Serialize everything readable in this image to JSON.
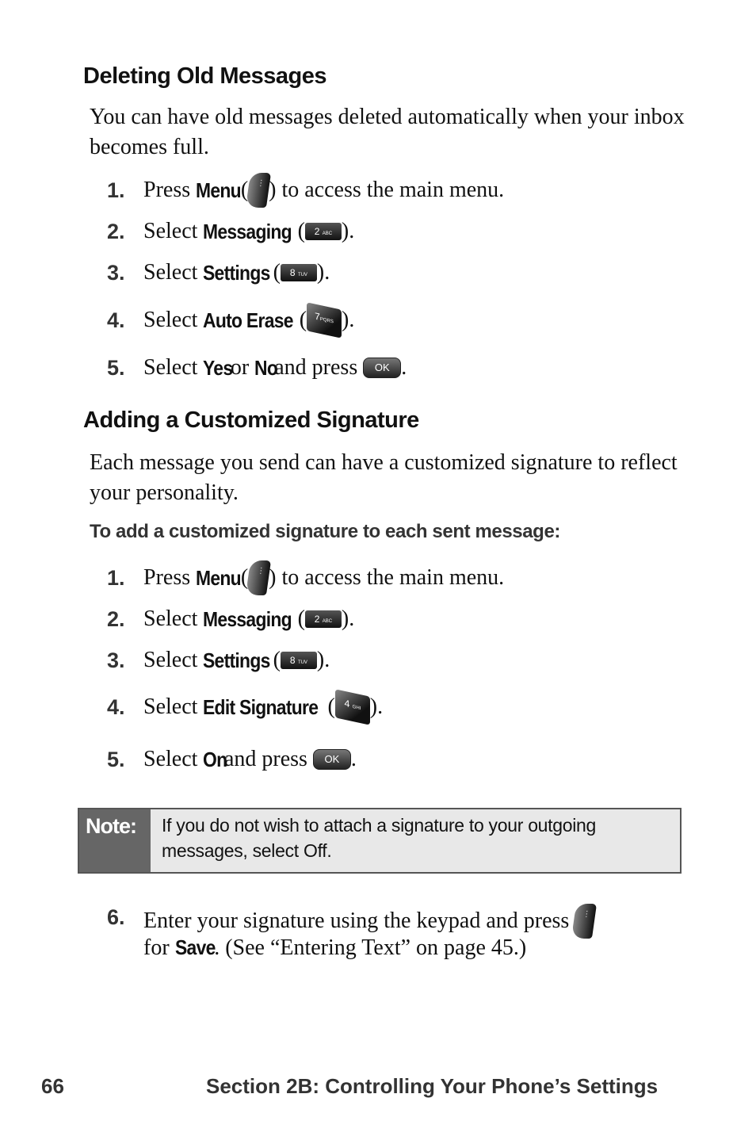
{
  "section1": {
    "title": "Deleting Old Messages",
    "intro": "You can have old messages deleted automatically when your inbox becomes full.",
    "steps": [
      {
        "num": "1.",
        "pre": "Press ",
        "bold": "Menu",
        "mid": " (",
        "post": ") to access the main menu.",
        "icon": "menu-softkey"
      },
      {
        "num": "2.",
        "pre": "Select ",
        "bold": "Messaging",
        "mid": " (",
        "post": ").",
        "key": "2",
        "key_sub": "ABC"
      },
      {
        "num": "3.",
        "pre": "Select ",
        "bold": "Settings",
        "mid": " (",
        "post": ").",
        "key": "8",
        "key_sub": "TUV"
      },
      {
        "num": "4.",
        "pre": "Select ",
        "bold": "Auto Erase",
        "mid": " (",
        "post": ").",
        "key": "7",
        "key_sub": "PQRS"
      },
      {
        "num": "5.",
        "pre": "Select ",
        "bold": "Yes",
        "mid": " or ",
        "bold2": "No",
        "mid2": " and press ",
        "key": "OK",
        "post": "."
      }
    ]
  },
  "section2": {
    "title": "Adding a Customized Signature",
    "intro": "Each message you send can have a customized signature to reflect your personality.",
    "subheading": "To add a customized signature to each sent message:",
    "steps": [
      {
        "num": "1.",
        "pre": "Press ",
        "bold": "Menu",
        "mid": " (",
        "post": ") to access the main menu."
      },
      {
        "num": "2.",
        "pre": "Select ",
        "bold": "Messaging",
        "mid": " (",
        "post": ").",
        "key": "2",
        "key_sub": "ABC"
      },
      {
        "num": "3.",
        "pre": "Select ",
        "bold": "Settings",
        "mid": " (",
        "post": ").",
        "key": "8",
        "key_sub": "TUV"
      },
      {
        "num": "4.",
        "pre": "Select ",
        "bold": "Edit Signature",
        "mid": " (",
        "post": ").",
        "key": "4",
        "key_sub": "GHI"
      },
      {
        "num": "5.",
        "pre": "Select ",
        "bold": "On",
        "mid": " and press ",
        "key": "OK",
        "post": "."
      }
    ],
    "note": {
      "label": "Note:",
      "text": "If you do not wish to attach a signature to your outgoing messages, select Off."
    },
    "step6": {
      "num": "6.",
      "line1": "Enter your signature using the keypad and press ",
      "line2_pre": "for ",
      "line2_bold": "Save",
      "line2_post": ". (See “Entering Text” on page 45.)"
    }
  },
  "footer": {
    "page_number": "66",
    "section": "Section 2B: Controlling Your Phone’s Settings"
  }
}
